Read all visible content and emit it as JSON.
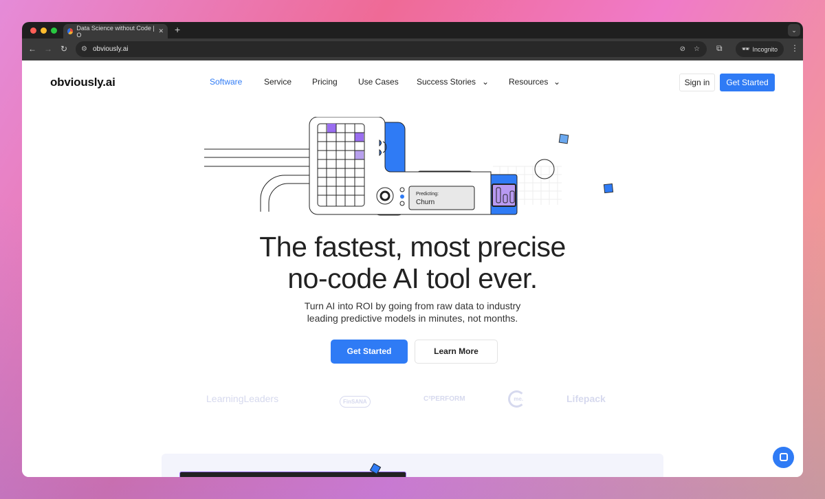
{
  "browser": {
    "tab_title": "Data Science without Code | O",
    "url": "obviously.ai",
    "incognito_label": "Incognito"
  },
  "header": {
    "logo": "obviously.ai",
    "nav": [
      {
        "label": "Software"
      },
      {
        "label": "Service"
      },
      {
        "label": "Pricing"
      },
      {
        "label": "Use Cases"
      },
      {
        "label": "Success Stories",
        "dropdown": true
      },
      {
        "label": "Resources",
        "dropdown": true
      }
    ],
    "sign_in": "Sign in",
    "get_started": "Get Started"
  },
  "hero": {
    "predicting_label": "Predicting:",
    "predicting_value": "Churn",
    "title_line1": "The fastest, most precise",
    "title_line2": "no-code AI tool ever.",
    "subtitle_line1": "Turn AI into ROI by going from raw data to industry",
    "subtitle_line2": "leading predictive models in minutes, not months.",
    "cta_primary": "Get Started",
    "cta_secondary": "Learn More"
  },
  "logos": [
    "LearningLeaders",
    "FinSANA",
    "C²PERFORM",
    "me.",
    "Lifepack"
  ],
  "colors": {
    "accent": "#2f7bf5",
    "purple": "#9a6ef0"
  }
}
